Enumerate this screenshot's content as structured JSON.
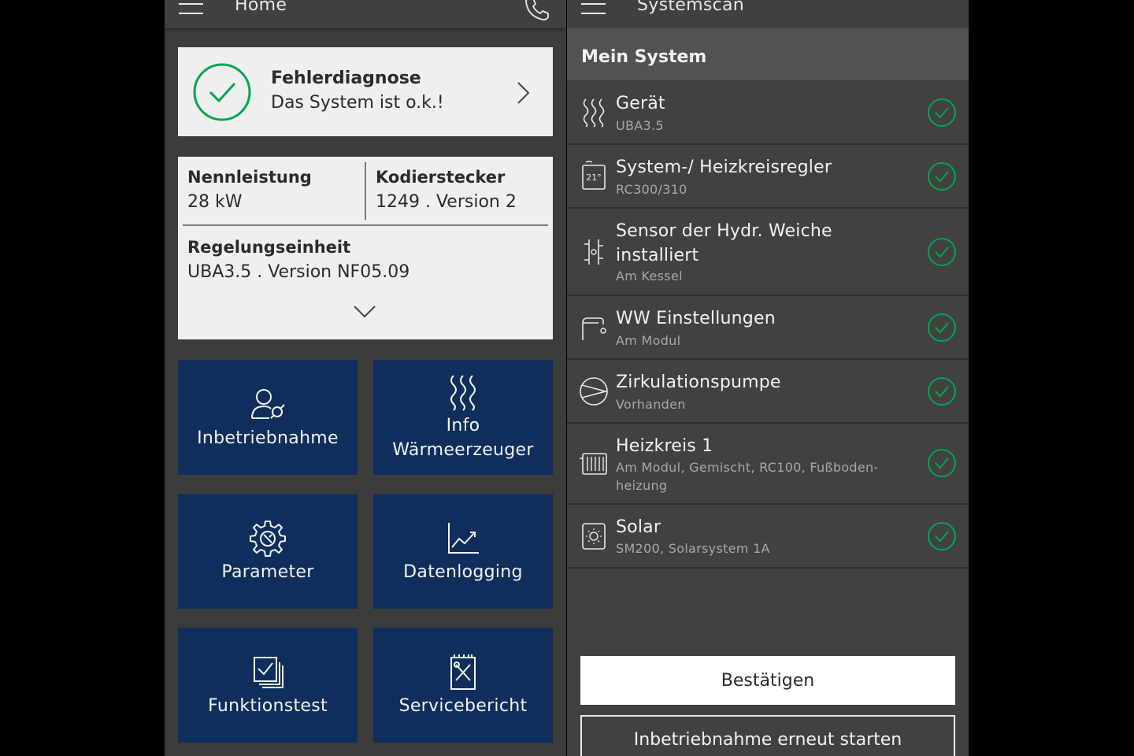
{
  "home": {
    "title": "Home",
    "menu_icon": "hamburger-menu-icon",
    "phone_icon": "phone-icon",
    "diagnosis": {
      "title": "Fehlerdiagnose",
      "status": "Das System ist o.k.!",
      "status_color": "#00a651"
    },
    "info": {
      "rated_power_label": "Nennleistung",
      "rated_power_value": "28 kW",
      "coding_plug_label": "Kodierstecker",
      "coding_plug_value": "1249 . Version 2",
      "control_unit_label": "Regelungseinheit",
      "control_unit_value": "UBA3.5 . Version NF05.09"
    },
    "tiles": [
      {
        "label": "Inbetriebnahme",
        "icon": "user-wrench-icon"
      },
      {
        "label_line1": "Info",
        "label_line2": "Wärmeerzeuger",
        "icon": "heat-waves-icon"
      },
      {
        "label": "Parameter",
        "icon": "gear-icon"
      },
      {
        "label": "Datenlogging",
        "icon": "chart-line-icon"
      },
      {
        "label": "Funktionstest",
        "icon": "checklist-icon"
      },
      {
        "label": "Servicebericht",
        "icon": "report-tools-icon"
      }
    ],
    "tile_color": "#0f2e5c"
  },
  "systemscan": {
    "title": "Systemscan",
    "section_title": "Mein System",
    "items": [
      {
        "name": "Gerät",
        "detail": "UBA3.5",
        "icon": "heat-waves-icon"
      },
      {
        "name": "System-/ Heizkreisregler",
        "detail": "RC300/310",
        "icon": "thermostat-icon"
      },
      {
        "name_line1": "Sensor der Hydr. Weiche",
        "name_line2": "installiert",
        "detail": "Am Kessel",
        "icon": "hydraulic-sensor-icon"
      },
      {
        "name": "WW Einstellungen",
        "detail": "Am Modul",
        "icon": "faucet-icon"
      },
      {
        "name": "Zirkulationspumpe",
        "detail": "Vorhanden",
        "icon": "pump-icon"
      },
      {
        "name": "Heizkreis 1",
        "detail_line1": "Am Modul, Gemischt, RC100, Fußboden-",
        "detail_line2": "heizung",
        "icon": "radiator-icon"
      },
      {
        "name": "Solar",
        "detail": "SM200, Solarsystem 1A",
        "icon": "solar-module-icon"
      }
    ],
    "ok_color": "#00a651",
    "confirm_button": "Bestätigen",
    "restart_button": "Inbetriebnahme erneut starten"
  }
}
